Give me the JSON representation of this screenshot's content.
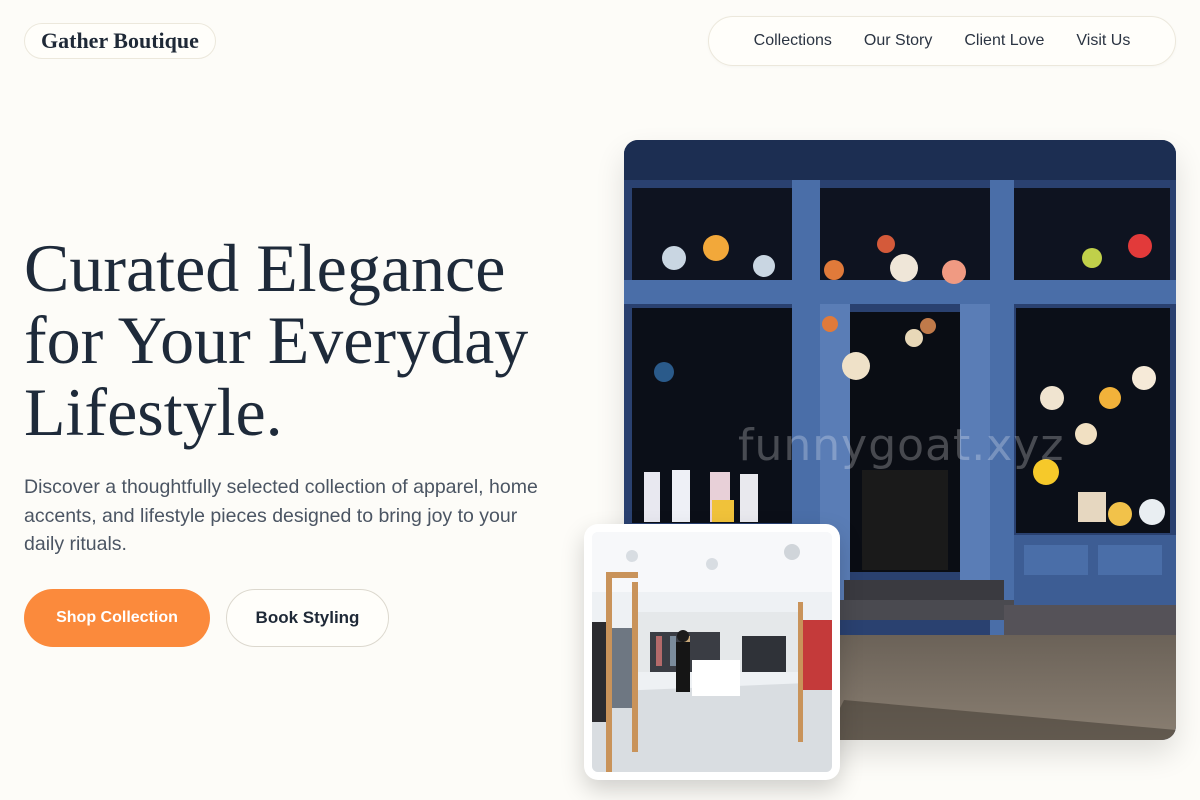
{
  "brand": {
    "name": "Gather Boutique"
  },
  "nav": {
    "items": [
      {
        "label": "Collections"
      },
      {
        "label": "Our Story"
      },
      {
        "label": "Client Love"
      },
      {
        "label": "Visit Us"
      }
    ]
  },
  "hero": {
    "headline_lines": [
      "Curated Elegance",
      "for Your Everyday",
      "Lifestyle."
    ],
    "subtext": "Discover a thoughtfully selected collection of apparel, home accents, and lifestyle pieces designed to bring joy to your daily rituals.",
    "primary_cta": "Shop Collection",
    "secondary_cta": "Book Styling"
  },
  "watermark": {
    "text": "funnygoat.xyz"
  },
  "colors": {
    "background": "#fdfcf8",
    "accent": "#fb8a3c",
    "heading": "#1e2a3a",
    "body_text": "#4b5563",
    "storefront_blue": "#4a6ea8"
  }
}
